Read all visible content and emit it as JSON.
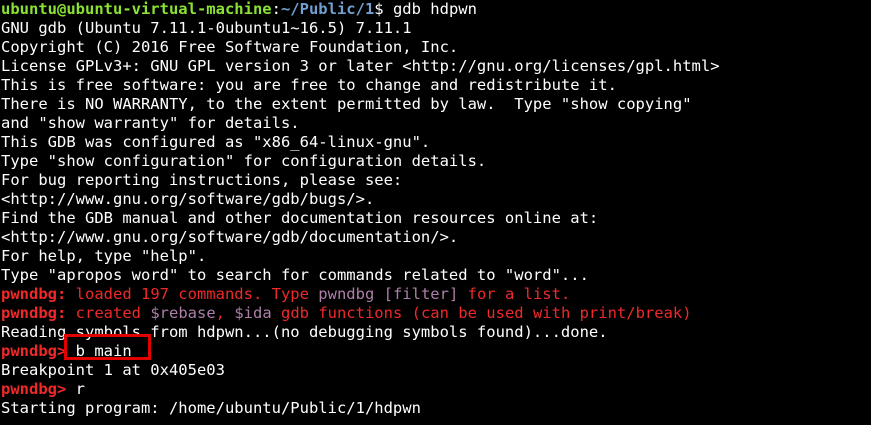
{
  "prompt": {
    "user_host": "ubuntu@ubuntu-virtual-machine",
    "separator": ":",
    "path": "~/Public/1",
    "dollar": "$ ",
    "command": "gdb hdpwn"
  },
  "gdb_banner": [
    "GNU gdb (Ubuntu 7.11.1-0ubuntu1~16.5) 7.11.1",
    "Copyright (C) 2016 Free Software Foundation, Inc.",
    "License GPLv3+: GNU GPL version 3 or later <http://gnu.org/licenses/gpl.html>",
    "This is free software: you are free to change and redistribute it.",
    "There is NO WARRANTY, to the extent permitted by law.  Type \"show copying\"",
    "and \"show warranty\" for details.",
    "This GDB was configured as \"x86_64-linux-gnu\".",
    "Type \"show configuration\" for configuration details.",
    "For bug reporting instructions, please see:",
    "<http://www.gnu.org/software/gdb/bugs/>.",
    "Find the GDB manual and other documentation resources online at:",
    "<http://www.gnu.org/software/gdb/documentation/>.",
    "For help, type \"help\".",
    "Type \"apropos word\" to search for commands related to \"word\"..."
  ],
  "pwndbg_loaded": {
    "prefix": "pwndbg:",
    "part1": " loaded 197 commands. Type ",
    "cmd": "pwndbg",
    "filter": " [filter]",
    "part2": " for a list."
  },
  "pwndbg_created": {
    "prefix": "pwndbg:",
    "part1": " created ",
    "rebase": "$rebase",
    "comma": ", ",
    "ida": "$ida",
    "part2": " gdb functions (can be used with print/break)"
  },
  "reading_symbols": "Reading symbols from hdpwn...(no debugging symbols found)...done.",
  "prompt_break": {
    "prompt": "pwndbg>",
    "command": " b main"
  },
  "breakpoint_line": "Breakpoint 1 at 0x405e03",
  "prompt_run": {
    "prompt": "pwndbg>",
    "command": " r"
  },
  "starting_program": "Starting program: /home/ubuntu/Public/1/hdpwn",
  "colors": {
    "background": "#000000",
    "prompt_green": "#8ae234",
    "path_blue": "#729fcf",
    "pwndbg_red": "#ef2929",
    "function_magenta": "#ad7fa8",
    "highlight_box": "#e00000"
  }
}
